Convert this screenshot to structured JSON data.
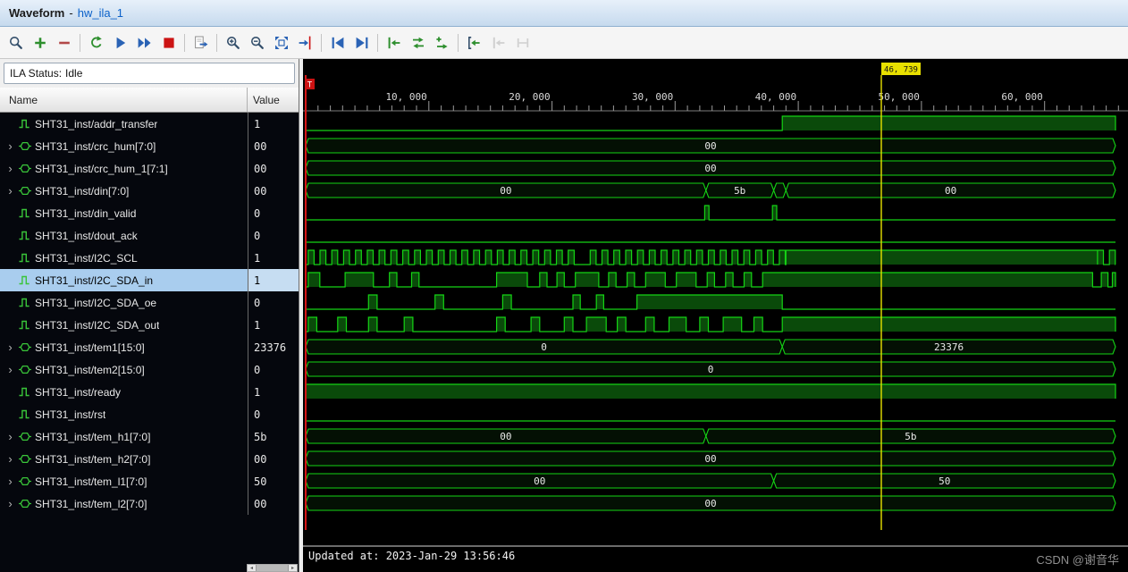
{
  "window": {
    "app_title": "Waveform",
    "separator": "-",
    "document": "hw_ila_1"
  },
  "ila_status": {
    "label": "ILA Status:",
    "value": "Idle"
  },
  "columns": {
    "name": "Name",
    "value": "Value"
  },
  "scrollbar": {
    "left_arrow": "◂",
    "right_arrow": "▸"
  },
  "toolbar": {
    "items": [
      {
        "icon": "find",
        "name": "find"
      },
      {
        "icon": "add",
        "name": "add-probes"
      },
      {
        "icon": "remove",
        "name": "remove-probes"
      },
      {
        "sep": true
      },
      {
        "icon": "run-loop",
        "name": "run-trigger-continuous"
      },
      {
        "icon": "run",
        "name": "run-trigger"
      },
      {
        "icon": "run-fast",
        "name": "run-trigger-immediate"
      },
      {
        "icon": "stop",
        "name": "stop-trigger"
      },
      {
        "sep": true
      },
      {
        "icon": "export",
        "name": "export-ila-data"
      },
      {
        "sep": true
      },
      {
        "icon": "zoom-in",
        "name": "zoom-in"
      },
      {
        "icon": "zoom-out",
        "name": "zoom-out"
      },
      {
        "icon": "zoom-fit",
        "name": "zoom-fit"
      },
      {
        "icon": "zoom-cursor",
        "name": "zoom-to-cursor"
      },
      {
        "sep": true
      },
      {
        "icon": "goto-start",
        "name": "go-to-start"
      },
      {
        "icon": "goto-end",
        "name": "go-to-end"
      },
      {
        "sep": true
      },
      {
        "icon": "trig-to-bar",
        "name": "set-trigger-position-start"
      },
      {
        "icon": "trig-swap",
        "name": "set-trigger-position-center"
      },
      {
        "icon": "trig-add",
        "name": "add-trigger"
      },
      {
        "sep": true
      },
      {
        "icon": "trig-bracket",
        "name": "go-to-trigger"
      },
      {
        "icon": "trig-prev",
        "name": "previous-transition",
        "enabled": false
      },
      {
        "icon": "range",
        "name": "transition-range",
        "enabled": false
      }
    ]
  },
  "selected_signal": "SHT31_inst/I2C_SDA_in",
  "signals": [
    {
      "name": "SHT31_inst/addr_transfer",
      "value": "1",
      "kind": "bit",
      "wave": {
        "high": [
          [
            38700,
            65760
          ]
        ]
      }
    },
    {
      "name": "SHT31_inst/crc_hum[7:0]",
      "value": "00",
      "kind": "bus",
      "wave": {
        "segments": [
          {
            "label": "00",
            "from": 0,
            "to": 65760
          }
        ]
      }
    },
    {
      "name": "SHT31_inst/crc_hum_1[7:1]",
      "value": "00",
      "kind": "bus",
      "wave": {
        "segments": [
          {
            "label": "00",
            "from": 0,
            "to": 65760
          }
        ]
      }
    },
    {
      "name": "SHT31_inst/din[7:0]",
      "value": "00",
      "kind": "bus",
      "wave": {
        "segments": [
          {
            "label": "00",
            "from": 0,
            "to": 32500
          },
          {
            "label": "5b",
            "from": 32500,
            "to": 38000
          },
          {
            "label": "",
            "from": 38000,
            "to": 39000
          },
          {
            "label": "00",
            "from": 39000,
            "to": 65760
          }
        ]
      }
    },
    {
      "name": "SHT31_inst/din_valid",
      "value": "0",
      "kind": "bit",
      "wave": {
        "high": [
          [
            32400,
            32750
          ],
          [
            37900,
            38250
          ]
        ]
      }
    },
    {
      "name": "SHT31_inst/dout_ack",
      "value": "0",
      "kind": "bit",
      "wave": {
        "high": []
      }
    },
    {
      "name": "SHT31_inst/I2C_SCL",
      "value": "1",
      "kind": "bit",
      "wave": {
        "high": [
          [
            39000,
            64300
          ]
        ],
        "clocks": [
          {
            "from": 200,
            "to": 22200,
            "period": 960
          },
          {
            "from": 23100,
            "to": 39000,
            "period": 960
          },
          {
            "from": 64300,
            "to": 65760,
            "period": 960
          }
        ]
      }
    },
    {
      "name": "SHT31_inst/I2C_SDA_in",
      "value": "1",
      "kind": "bit",
      "wave": {
        "high": [
          [
            200,
            1150
          ],
          [
            3200,
            5500
          ],
          [
            6800,
            7400
          ],
          [
            8600,
            9200
          ],
          [
            15500,
            18000
          ],
          [
            19000,
            19600
          ],
          [
            20400,
            21000
          ],
          [
            21900,
            23800
          ],
          [
            24600,
            25200
          ],
          [
            26100,
            26700
          ],
          [
            27600,
            29200
          ],
          [
            30100,
            31700
          ],
          [
            32600,
            33200
          ],
          [
            34100,
            34700
          ],
          [
            35600,
            36200
          ],
          [
            37100,
            63900
          ],
          [
            64600,
            65150
          ],
          [
            65500,
            65760
          ]
        ]
      }
    },
    {
      "name": "SHT31_inst/I2C_SDA_oe",
      "value": "0",
      "kind": "bit",
      "wave": {
        "high": [
          [
            5100,
            5800
          ],
          [
            10500,
            11200
          ],
          [
            16000,
            16700
          ],
          [
            21700,
            22300
          ],
          [
            23600,
            24200
          ],
          [
            26900,
            38700
          ]
        ]
      }
    },
    {
      "name": "SHT31_inst/I2C_SDA_out",
      "value": "1",
      "kind": "bit",
      "wave": {
        "high": [
          [
            200,
            900
          ],
          [
            2600,
            3300
          ],
          [
            5100,
            5800
          ],
          [
            8000,
            8700
          ],
          [
            15500,
            16200
          ],
          [
            18300,
            19000
          ],
          [
            21000,
            21700
          ],
          [
            22800,
            24400
          ],
          [
            25300,
            26000
          ],
          [
            27600,
            28300
          ],
          [
            29500,
            30900
          ],
          [
            32000,
            32700
          ],
          [
            33900,
            35400
          ],
          [
            36400,
            37100
          ],
          [
            38700,
            65760
          ]
        ]
      }
    },
    {
      "name": "SHT31_inst/tem1[15:0]",
      "value": "23376",
      "kind": "bus",
      "wave": {
        "segments": [
          {
            "label": "0",
            "from": 0,
            "to": 38700
          },
          {
            "label": "23376",
            "from": 38700,
            "to": 65760
          }
        ]
      }
    },
    {
      "name": "SHT31_inst/tem2[15:0]",
      "value": "0",
      "kind": "bus",
      "wave": {
        "segments": [
          {
            "label": "0",
            "from": 0,
            "to": 65760
          }
        ]
      }
    },
    {
      "name": "SHT31_inst/ready",
      "value": "1",
      "kind": "bit",
      "wave": {
        "high": [
          [
            0,
            65760
          ]
        ]
      }
    },
    {
      "name": "SHT31_inst/rst",
      "value": "0",
      "kind": "bit",
      "wave": {
        "high": []
      }
    },
    {
      "name": "SHT31_inst/tem_h1[7:0]",
      "value": "5b",
      "kind": "bus",
      "wave": {
        "segments": [
          {
            "label": "00",
            "from": 0,
            "to": 32500
          },
          {
            "label": "5b",
            "from": 32500,
            "to": 65760
          }
        ]
      }
    },
    {
      "name": "SHT31_inst/tem_h2[7:0]",
      "value": "00",
      "kind": "bus",
      "wave": {
        "segments": [
          {
            "label": "00",
            "from": 0,
            "to": 65760
          }
        ]
      }
    },
    {
      "name": "SHT31_inst/tem_l1[7:0]",
      "value": "50",
      "kind": "bus",
      "wave": {
        "segments": [
          {
            "label": "00",
            "from": 0,
            "to": 38000
          },
          {
            "label": "50",
            "from": 38000,
            "to": 65760
          }
        ]
      }
    },
    {
      "name": "SHT31_inst/tem_l2[7:0]",
      "value": "00",
      "kind": "bus",
      "wave": {
        "segments": [
          {
            "label": "00",
            "from": 0,
            "to": 65760
          }
        ]
      }
    }
  ],
  "timeline": {
    "t_end": 66300,
    "wave_end": 65760,
    "minor_step": 1000,
    "major_ticks": [
      {
        "t": 10000,
        "label": "10, 000"
      },
      {
        "t": 20000,
        "label": "20, 000"
      },
      {
        "t": 30000,
        "label": "30, 000"
      },
      {
        "t": 40000,
        "label": "40, 000"
      },
      {
        "t": 50000,
        "label": "50, 000"
      },
      {
        "t": 60000,
        "label": "60, 000"
      }
    ],
    "cursor": {
      "t": 46739,
      "label": "46, 739"
    },
    "trigger": {
      "t": 0,
      "label": "T"
    }
  },
  "status_bar": {
    "updated": "Updated at: 2023-Jan-29 13:56:46"
  },
  "watermark": "CSDN @谢音华",
  "colors": {
    "wave_green": "#15d415",
    "wave_fill": "#0a4a0a",
    "cursor_yellow": "#e8e000",
    "trigger_red": "#d61616",
    "selection_blue": "#a9cdee"
  }
}
